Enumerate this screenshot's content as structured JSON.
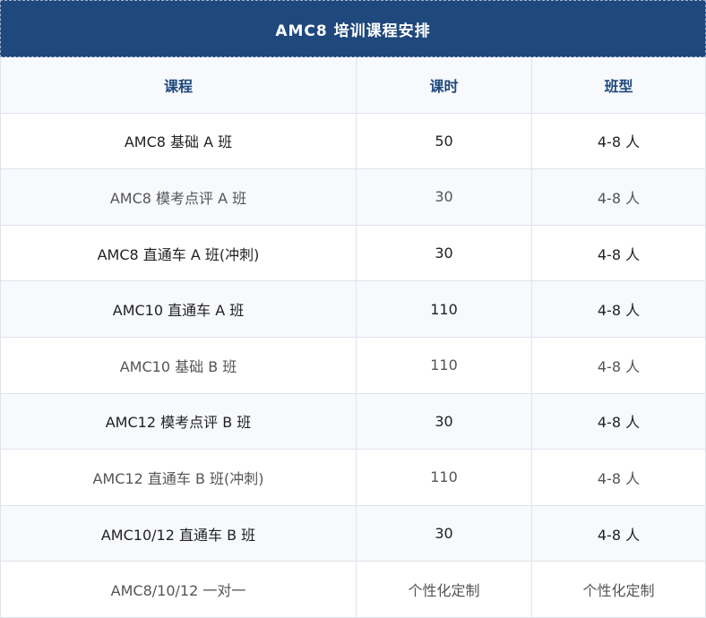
{
  "table": {
    "title": "AMC8 培训课程安排",
    "headers": [
      "课程",
      "课时",
      "班型"
    ],
    "rows": [
      {
        "course": "AMC8 基础 A 班",
        "hours": "50",
        "size": "4-8 人"
      },
      {
        "course": "AMC8 模考点评 A 班",
        "hours": "30",
        "size": "4-8 人"
      },
      {
        "course": "AMC8 直通车 A 班(冲刺)",
        "hours": "30",
        "size": "4-8 人"
      },
      {
        "course": "AMC10 直通车 A 班",
        "hours": "110",
        "size": "4-8 人"
      },
      {
        "course": "AMC10 基础 B 班",
        "hours": "110",
        "size": "4-8 人"
      },
      {
        "course": "AMC12 模考点评 B 班",
        "hours": "30",
        "size": "4-8 人"
      },
      {
        "course": "AMC12 直通车 B 班(冲刺)",
        "hours": "110",
        "size": "4-8 人"
      },
      {
        "course": "AMC10/12 直通车 B 班",
        "hours": "30",
        "size": "4-8 人"
      },
      {
        "course": "AMC8/10/12 一对一",
        "hours": "个性化定制",
        "size": "个性化定制"
      }
    ]
  },
  "colors": {
    "title_bg": "#1f487c",
    "header_text": "#1f487c",
    "row_alt_bg": "#f7f9fd",
    "border": "#dfe3ea"
  }
}
